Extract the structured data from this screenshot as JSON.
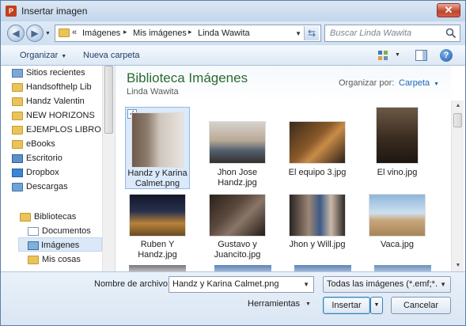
{
  "window": {
    "title": "Insertar imagen",
    "app_icon_letter": "P",
    "close_glyph": "✕"
  },
  "address": {
    "chevron": "«",
    "crumbs": [
      "Imágenes",
      "Mis imágenes",
      "Linda Wawita"
    ],
    "separator": "▸"
  },
  "search": {
    "placeholder": "Buscar Linda Wawita"
  },
  "toolbar": {
    "organize_label": "Organizar",
    "new_folder_label": "Nueva carpeta",
    "help_glyph": "?"
  },
  "sidebar": {
    "items": [
      {
        "label": "Sitios recientes",
        "icon": "recent-places-icon"
      },
      {
        "label": "Handsofthelp Lib",
        "icon": "folder-icon"
      },
      {
        "label": "Handz Valentin",
        "icon": "folder-icon"
      },
      {
        "label": "NEW HORIZONS",
        "icon": "folder-icon"
      },
      {
        "label": "EJEMPLOS LIBRO",
        "icon": "folder-icon"
      },
      {
        "label": "eBooks",
        "icon": "folder-icon"
      },
      {
        "label": "Escritorio",
        "icon": "desktop-icon"
      },
      {
        "label": "Dropbox",
        "icon": "dropbox-icon"
      },
      {
        "label": "Descargas",
        "icon": "downloads-icon"
      }
    ],
    "libraries": {
      "label": "Bibliotecas",
      "items": [
        {
          "label": "Documentos",
          "icon": "documents-icon"
        },
        {
          "label": "Imágenes",
          "icon": "pictures-icon",
          "selected": true
        },
        {
          "label": "Mis cosas",
          "icon": "folder-icon"
        }
      ]
    }
  },
  "library": {
    "title": "Biblioteca Imágenes",
    "subtitle": "Linda Wawita",
    "arrange_label": "Organizar por:",
    "arrange_value": "Carpeta"
  },
  "files": [
    {
      "name": "Handz y Karina Calmet.png",
      "selected": true,
      "check": "✓"
    },
    {
      "name": "Jhon Jose Handz.jpg"
    },
    {
      "name": "El equipo 3.jpg"
    },
    {
      "name": "El vino.jpg"
    },
    {
      "name": "Ruben Y Handz.jpg"
    },
    {
      "name": "Gustavo y Juancito.jpg"
    },
    {
      "name": "Jhon y Will.jpg"
    },
    {
      "name": "Vaca.jpg"
    }
  ],
  "footer": {
    "filename_label": "Nombre de archivo:",
    "filename_value": "Handz y Karina Calmet.png",
    "filter_value": "Todas las imágenes (*.emf;*.wr",
    "tools_label": "Herramientas",
    "insert_label": "Insertar",
    "cancel_label": "Cancelar"
  },
  "colors": {
    "accent": "#1f65b4",
    "library_title": "#2b6a2f",
    "selection": "#dbe9fa"
  }
}
